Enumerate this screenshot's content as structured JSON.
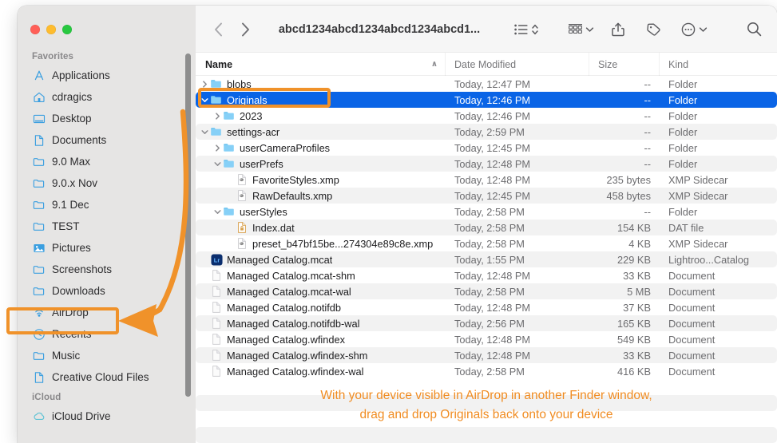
{
  "window": {
    "title": "abcd1234abcd1234abcd1234abcd1...",
    "traffic": {
      "close": "close-button",
      "minimize": "minimize-button",
      "zoom": "zoom-button"
    }
  },
  "toolbar": {
    "back": "‹",
    "forward": "›",
    "view_list": "list-view",
    "view_stepper": "view-stepper",
    "group_by": "group-by",
    "share": "share",
    "tags": "tags",
    "more": "more-actions",
    "search": "search"
  },
  "columns": {
    "name": "Name",
    "date_modified": "Date Modified",
    "size": "Size",
    "kind": "Kind",
    "sort_indicator": "∧"
  },
  "sidebar": {
    "sections": [
      {
        "title": "Favorites",
        "items": [
          {
            "label": "Applications",
            "icon": "applications-icon"
          },
          {
            "label": "cdragics",
            "icon": "home-icon"
          },
          {
            "label": "Desktop",
            "icon": "desktop-icon"
          },
          {
            "label": "Documents",
            "icon": "document-icon"
          },
          {
            "label": "9.0 Max",
            "icon": "folder-icon"
          },
          {
            "label": "9.0.x Nov",
            "icon": "folder-icon"
          },
          {
            "label": "9.1 Dec",
            "icon": "folder-icon"
          },
          {
            "label": "TEST",
            "icon": "folder-icon"
          },
          {
            "label": "Pictures",
            "icon": "pictures-icon"
          },
          {
            "label": "Screenshots",
            "icon": "folder-icon"
          },
          {
            "label": "Downloads",
            "icon": "folder-icon"
          },
          {
            "label": "AirDrop",
            "icon": "airdrop-icon",
            "highlighted": true
          },
          {
            "label": "Recents",
            "icon": "clock-icon"
          },
          {
            "label": "Music",
            "icon": "folder-icon"
          },
          {
            "label": "Creative Cloud Files",
            "icon": "document-icon"
          }
        ]
      },
      {
        "title": "iCloud",
        "items": [
          {
            "label": "iCloud Drive",
            "icon": "cloud-icon"
          }
        ]
      }
    ]
  },
  "files": [
    {
      "name": "blobs",
      "date": "Today, 12:47 PM",
      "size": "--",
      "kind": "Folder",
      "indent": 0,
      "disclosure": "closed",
      "icon": "folder-icon",
      "stripe": false
    },
    {
      "name": "Originals",
      "date": "Today, 12:46 PM",
      "size": "--",
      "kind": "Folder",
      "indent": 0,
      "disclosure": "open",
      "icon": "folder-icon",
      "selected": true
    },
    {
      "name": "2023",
      "date": "Today, 12:46 PM",
      "size": "--",
      "kind": "Folder",
      "indent": 1,
      "disclosure": "closed",
      "icon": "folder-icon",
      "stripe": false
    },
    {
      "name": "settings-acr",
      "date": "Today, 2:59 PM",
      "size": "--",
      "kind": "Folder",
      "indent": 0,
      "disclosure": "open",
      "icon": "folder-icon",
      "stripe": true
    },
    {
      "name": "userCameraProfiles",
      "date": "Today, 12:45 PM",
      "size": "--",
      "kind": "Folder",
      "indent": 1,
      "disclosure": "closed",
      "icon": "folder-icon",
      "stripe": false
    },
    {
      "name": "userPrefs",
      "date": "Today, 12:48 PM",
      "size": "--",
      "kind": "Folder",
      "indent": 1,
      "disclosure": "open",
      "icon": "folder-icon",
      "stripe": true
    },
    {
      "name": "FavoriteStyles.xmp",
      "date": "Today, 12:48 PM",
      "size": "235 bytes",
      "kind": "XMP Sidecar",
      "indent": 2,
      "disclosure": "none",
      "icon": "xmp-icon",
      "stripe": false
    },
    {
      "name": "RawDefaults.xmp",
      "date": "Today, 12:45 PM",
      "size": "458 bytes",
      "kind": "XMP Sidecar",
      "indent": 2,
      "disclosure": "none",
      "icon": "xmp-icon",
      "stripe": true
    },
    {
      "name": "userStyles",
      "date": "Today, 2:58 PM",
      "size": "--",
      "kind": "Folder",
      "indent": 1,
      "disclosure": "open",
      "icon": "folder-icon",
      "stripe": false
    },
    {
      "name": "Index.dat",
      "date": "Today, 2:58 PM",
      "size": "154 KB",
      "kind": "DAT file",
      "indent": 2,
      "disclosure": "none",
      "icon": "dat-icon",
      "stripe": true
    },
    {
      "name": "preset_b47bf15be...274304e89c8e.xmp",
      "date": "Today, 2:58 PM",
      "size": "4 KB",
      "kind": "XMP Sidecar",
      "indent": 2,
      "disclosure": "none",
      "icon": "xmp-icon",
      "stripe": false
    },
    {
      "name": "Managed Catalog.mcat",
      "date": "Today, 1:55 PM",
      "size": "229 KB",
      "kind": "Lightroo...Catalog",
      "indent": 0,
      "disclosure": "none",
      "icon": "lightroom-icon",
      "stripe": true
    },
    {
      "name": "Managed Catalog.mcat-shm",
      "date": "Today, 12:48 PM",
      "size": "33 KB",
      "kind": "Document",
      "indent": 0,
      "disclosure": "none",
      "icon": "doc-icon",
      "stripe": false
    },
    {
      "name": "Managed Catalog.mcat-wal",
      "date": "Today, 2:58 PM",
      "size": "5 MB",
      "kind": "Document",
      "indent": 0,
      "disclosure": "none",
      "icon": "doc-icon",
      "stripe": true
    },
    {
      "name": "Managed Catalog.notifdb",
      "date": "Today, 12:48 PM",
      "size": "37 KB",
      "kind": "Document",
      "indent": 0,
      "disclosure": "none",
      "icon": "doc-icon",
      "stripe": false
    },
    {
      "name": "Managed Catalog.notifdb-wal",
      "date": "Today, 2:56 PM",
      "size": "165 KB",
      "kind": "Document",
      "indent": 0,
      "disclosure": "none",
      "icon": "doc-icon",
      "stripe": true
    },
    {
      "name": "Managed Catalog.wfindex",
      "date": "Today, 12:48 PM",
      "size": "549 KB",
      "kind": "Document",
      "indent": 0,
      "disclosure": "none",
      "icon": "doc-icon",
      "stripe": false
    },
    {
      "name": "Managed Catalog.wfindex-shm",
      "date": "Today, 12:48 PM",
      "size": "33 KB",
      "kind": "Document",
      "indent": 0,
      "disclosure": "none",
      "icon": "doc-icon",
      "stripe": true
    },
    {
      "name": "Managed Catalog.wfindex-wal",
      "date": "Today, 2:58 PM",
      "size": "416 KB",
      "kind": "Document",
      "indent": 0,
      "disclosure": "none",
      "icon": "doc-icon",
      "stripe": false
    }
  ],
  "annotation": {
    "color": "#f0922a",
    "caption_line1": "With your device visible in AirDrop in another Finder window,",
    "caption_line2": "drag and drop Originals back onto your device",
    "highlight_originals": "Originals",
    "highlight_airdrop": "AirDrop",
    "arrow": "curved-arrow-originals-to-airdrop"
  }
}
